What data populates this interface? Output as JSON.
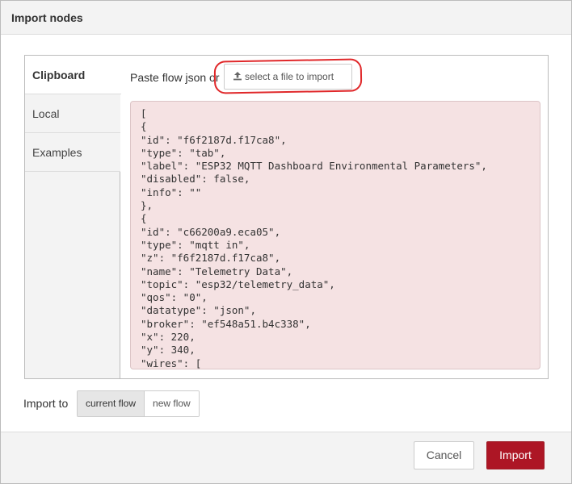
{
  "dialog": {
    "title": "Import nodes"
  },
  "sidebar": {
    "tabs": [
      {
        "label": "Clipboard",
        "active": true
      },
      {
        "label": "Local",
        "active": false
      },
      {
        "label": "Examples",
        "active": false
      }
    ]
  },
  "clipboard": {
    "paste_label": "Paste flow json or",
    "select_file_label": "select a file to import",
    "select_file_icon": "upload-icon",
    "json_text": "[\n{\n\"id\": \"f6f2187d.f17ca8\",\n\"type\": \"tab\",\n\"label\": \"ESP32 MQTT Dashboard Environmental Parameters\",\n\"disabled\": false,\n\"info\": \"\"\n},\n{\n\"id\": \"c66200a9.eca05\",\n\"type\": \"mqtt in\",\n\"z\": \"f6f2187d.f17ca8\",\n\"name\": \"Telemetry Data\",\n\"topic\": \"esp32/telemetry_data\",\n\"qos\": \"0\",\n\"datatype\": \"json\",\n\"broker\": \"ef548a51.b4c338\",\n\"x\": 220,\n\"y\": 340,\n\"wires\": [\n["
  },
  "import_to": {
    "label": "Import to",
    "options": [
      {
        "label": "current flow",
        "selected": true
      },
      {
        "label": "new flow",
        "selected": false
      }
    ]
  },
  "footer": {
    "cancel_label": "Cancel",
    "import_label": "Import"
  },
  "colors": {
    "accent": "#ad1625",
    "editor_bg": "#f5e2e3",
    "highlight": "#e0282a"
  }
}
